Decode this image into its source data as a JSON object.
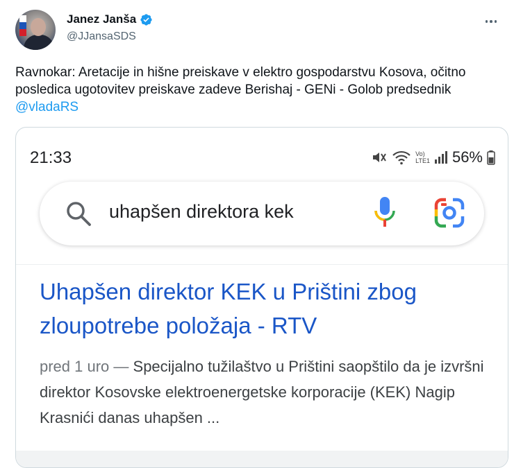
{
  "author": {
    "name": "Janez Janša",
    "handle": "@JJansaSDS"
  },
  "tweet": {
    "text": "Ravnokar: Aretacije in hišne preiskave v elektro gospodarstvu Kosova, očitno posledica ugotovitev preiskave zadeve Berishaj - GENi - Golob predsednik ",
    "mention": "@vladaRS"
  },
  "phone": {
    "time": "21:33",
    "battery": "56%",
    "network_label_top": "Vo)",
    "network_label_bottom": "LTE1",
    "search_query": "uhapšen direktora kek",
    "result": {
      "title": "Uhapšen direktor KEK u Prištini zbog zloupotrebe položaja - RTV",
      "date": "pred 1 uro — ",
      "snippet": "Specijalno tužilaštvo u Prištini saopštilo da je izvršni direktor Kosovske elektroenergetske korporacije (KEK) Nagip Krasnići danas uhapšen ..."
    }
  },
  "colors": {
    "verified": "#1d9bf0",
    "mention": "#1d9bf0",
    "result_link": "#1a56c7",
    "handle": "#536471"
  },
  "icons": [
    "verified-badge-icon",
    "more-options-icon",
    "mute-icon",
    "wifi-icon",
    "signal-icon",
    "battery-icon",
    "search-icon",
    "microphone-icon",
    "google-lens-icon"
  ]
}
